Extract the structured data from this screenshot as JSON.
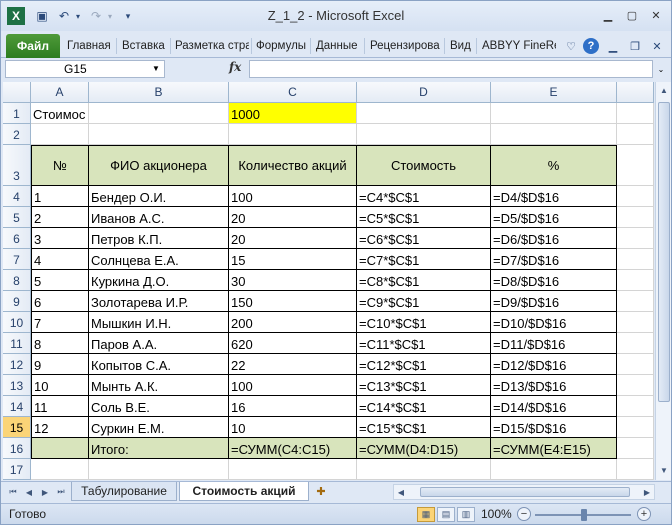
{
  "title": "Z_1_2  -  Microsoft Excel",
  "ribbon": {
    "file_tab": "Файл",
    "tabs": [
      "Главная",
      "Вставка",
      "Разметка стра",
      "Формулы",
      "Данные",
      "Рецензирова",
      "Вид",
      "ABBYY FineRe"
    ]
  },
  "formula_bar": {
    "name_box": "G15",
    "fx": "fx",
    "formula": ""
  },
  "columns": [
    "A",
    "B",
    "C",
    "D",
    "E"
  ],
  "rows": [
    "1",
    "2",
    "3",
    "4",
    "5",
    "6",
    "7",
    "8",
    "9",
    "10",
    "11",
    "12",
    "13",
    "14",
    "15",
    "16",
    "17"
  ],
  "selected_row": "15",
  "cells": {
    "A1": "Стоимос",
    "C1": "1000",
    "header": [
      "№",
      "ФИО акционера",
      "Количество акций",
      "Стоимость",
      "%"
    ],
    "data": [
      [
        "1",
        "Бендер О.И.",
        "100",
        "=C4*$C$1",
        "=D4/$D$16"
      ],
      [
        "2",
        "Иванов А.С.",
        "20",
        "=C5*$C$1",
        "=D5/$D$16"
      ],
      [
        "3",
        "Петров К.П.",
        "20",
        "=C6*$C$1",
        "=D6/$D$16"
      ],
      [
        "4",
        "Солнцева Е.А.",
        "15",
        "=C7*$C$1",
        "=D7/$D$16"
      ],
      [
        "5",
        "Куркина Д.О.",
        "30",
        "=C8*$C$1",
        "=D8/$D$16"
      ],
      [
        "6",
        "Золотарева И.Р.",
        "150",
        "=C9*$C$1",
        "=D9/$D$16"
      ],
      [
        "7",
        "Мышкин И.Н.",
        "200",
        "=C10*$C$1",
        "=D10/$D$16"
      ],
      [
        "8",
        "Паров А.А.",
        "620",
        "=C11*$C$1",
        "=D11/$D$16"
      ],
      [
        "9",
        "Копытов С.А.",
        "22",
        "=C12*$C$1",
        "=D12/$D$16"
      ],
      [
        "10",
        "Мынть А.К.",
        "100",
        "=C13*$C$1",
        "=D13/$D$16"
      ],
      [
        "11",
        "Соль В.Е.",
        "16",
        "=C14*$C$1",
        "=D14/$D$16"
      ],
      [
        "12",
        "Суркин Е.М.",
        "10",
        "=C15*$C$1",
        "=D15/$D$16"
      ]
    ],
    "total": [
      "",
      "Итого:",
      "=СУММ(C4:C15)",
      "=СУММ(D4:D15)",
      "=СУММ(E4:E15)"
    ]
  },
  "sheets": [
    "Табулирование",
    "Стоимость акций"
  ],
  "active_sheet": "Стоимость акций",
  "status": {
    "ready": "Готово",
    "zoom": "100%"
  },
  "colors": {
    "header_fill": "#d8e4bc",
    "highlight": "#ffff00",
    "file_tab": "#2c7d1f"
  }
}
